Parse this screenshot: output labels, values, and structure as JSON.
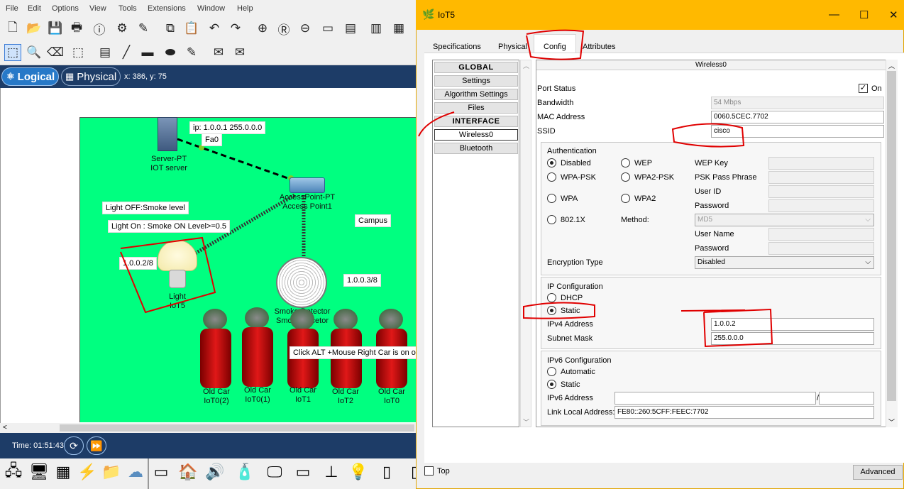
{
  "menu": [
    "File",
    "Edit",
    "Options",
    "View",
    "Tools",
    "Extensions",
    "Window",
    "Help"
  ],
  "workspace": {
    "logical_label": "Logical",
    "physical_label": "Physical",
    "coords": "x: 386, y: 75"
  },
  "canvas": {
    "ip_label": "ip: 1.0.0.1 255.0.0.0",
    "fa0_label": "Fa0",
    "server_type": "Server-PT",
    "server_name": "IOT server",
    "ap_type": "AccessPoint-PT",
    "ap_name": "Access Point1",
    "light_off_note": "Light OFF:Smoke level",
    "light_on_note": "Light On : Smoke ON Level>=0.5",
    "campus_label": "Campus",
    "light_ip": "1.0.0.2/8",
    "light_type": "Light",
    "light_name": "IoT5",
    "smoke_ip": "1.0.0.3/8",
    "smoke_type": "Smoke Detector",
    "smoke_name": "Smoke decetor",
    "car_note": "Click ALT +Mouse Right Car is on or",
    "cars": [
      {
        "type": "Old Car",
        "name": "IoT0(2)"
      },
      {
        "type": "Old Car",
        "name": "IoT0(1)"
      },
      {
        "type": "Old Car",
        "name": "IoT1"
      },
      {
        "type": "Old Car",
        "name": "IoT2"
      },
      {
        "type": "Old Car",
        "name": "IoT0"
      }
    ]
  },
  "timebar": {
    "time": "Time: 01:51:43"
  },
  "dialog": {
    "title": "IoT5",
    "tabs": [
      "Specifications",
      "Physical",
      "Config",
      "Attributes"
    ],
    "active_tab": "Config",
    "left_items": [
      "GLOBAL",
      "Settings",
      "Algorithm Settings",
      "Files",
      "INTERFACE",
      "Wireless0",
      "Bluetooth"
    ],
    "selected_item": "Wireless0",
    "pane_title": "Wireless0",
    "port_status_label": "Port Status",
    "on_label": "On",
    "port_on": true,
    "bandwidth_label": "Bandwidth",
    "bandwidth_value": "54 Mbps",
    "mac_label": "MAC Address",
    "mac_value": "0060.5CEC.7702",
    "ssid_label": "SSID",
    "ssid_value": "cisco",
    "auth": {
      "title": "Authentication",
      "disabled": "Disabled",
      "wep": "WEP",
      "wpa_psk": "WPA-PSK",
      "wpa2_psk": "WPA2-PSK",
      "wpa": "WPA",
      "wpa2": "WPA2",
      "dot1x": "802.1X",
      "method_label": "Method:",
      "method_value": "MD5",
      "wep_key": "WEP Key",
      "psk_phrase": "PSK Pass Phrase",
      "user_id": "User ID",
      "password": "Password",
      "user_name": "User Name",
      "password2": "Password",
      "selected": "Disabled"
    },
    "encryption_label": "Encryption Type",
    "encryption_value": "Disabled",
    "ip": {
      "title": "IP Configuration",
      "dhcp": "DHCP",
      "static": "Static",
      "selected": "Static",
      "ipv4_label": "IPv4 Address",
      "ipv4_value": "1.0.0.2",
      "mask_label": "Subnet Mask",
      "mask_value": "255.0.0.0"
    },
    "ipv6": {
      "title": "IPv6 Configuration",
      "automatic": "Automatic",
      "static": "Static",
      "selected": "Static",
      "addr_label": "IPv6 Address",
      "addr_sep": "/",
      "link_local_label": "Link Local Address:",
      "link_local_value": "FE80::260:5CFF:FEEC:7702"
    },
    "top_label": "Top",
    "advanced_label": "Advanced"
  }
}
